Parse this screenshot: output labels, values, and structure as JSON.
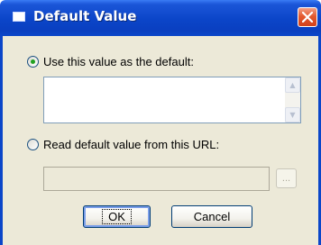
{
  "window": {
    "title": "Default Value"
  },
  "options": {
    "use_value_label": "Use this value as the default:",
    "use_value_selected": true,
    "default_value_text": "",
    "read_url_label": "Read default value from this URL:",
    "read_url_selected": false,
    "url_value": ""
  },
  "buttons": {
    "browse_label": "...",
    "ok_label": "OK",
    "cancel_label": "Cancel"
  },
  "icons": {
    "close": "close-icon",
    "window": "window-icon",
    "scroll_up": "scroll-up-icon",
    "scroll_down": "scroll-down-icon"
  },
  "colors": {
    "titlebar": "#0b46c9",
    "dialog_bg": "#ece9d8",
    "close_button": "#e4592f",
    "radio_selected": "#21a121"
  }
}
